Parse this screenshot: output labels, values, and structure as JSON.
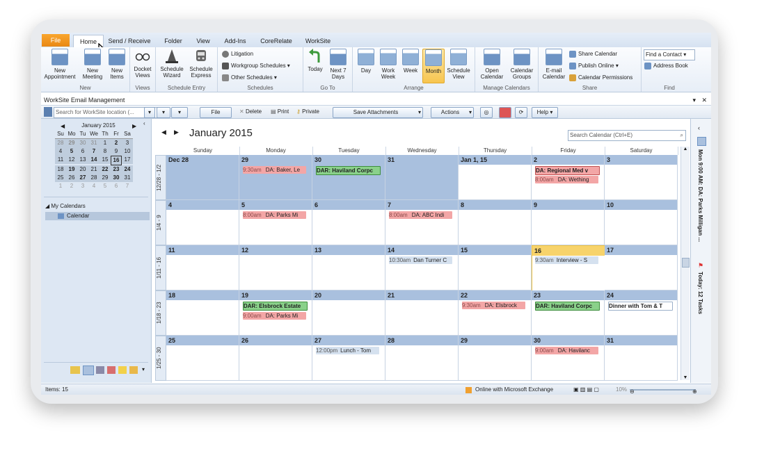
{
  "ribbon_tabs": [
    "File",
    "Home",
    "Send / Receive",
    "Folder",
    "View",
    "Add-Ins",
    "CoreRelate",
    "WorkSite"
  ],
  "ribbon": {
    "new": {
      "new_appointment": "New Appointment",
      "new_meeting": "New Meeting",
      "new_items": "New Items",
      "label": "New"
    },
    "views": {
      "docket_views": "Docket Views",
      "label": "Views"
    },
    "schedule_entry": {
      "schedule_wizard": "Schedule Wizard",
      "schedule_express": "Schedule Express",
      "label": "Schedule Entry"
    },
    "schedules": {
      "litigation": "Litigation",
      "workgroup": "Workgroup Schedules",
      "other": "Other Schedules",
      "label": "Schedules"
    },
    "goto": {
      "today": "Today",
      "next7": "Next 7 Days",
      "label": "Go To"
    },
    "arrange": {
      "day": "Day",
      "work_week": "Work Week",
      "week": "Week",
      "month": "Month",
      "schedule_view": "Schedule View",
      "label": "Arrange"
    },
    "manage": {
      "open_calendar": "Open Calendar",
      "calendar_groups": "Calendar Groups",
      "label": "Manage Calendars"
    },
    "share": {
      "email_calendar": "E-mail Calendar",
      "share_calendar": "Share Calendar",
      "publish_online": "Publish Online",
      "permissions": "Calendar Permissions",
      "label": "Share"
    },
    "find": {
      "find_contact": "Find a Contact",
      "address_book": "Address Book",
      "label": "Find"
    }
  },
  "worksite": {
    "title": "WorkSite Email Management",
    "search_placeholder": "Search for WorkSite location (...",
    "file": "File",
    "delete": "Delete",
    "print": "Print",
    "private": "Private",
    "save_attachments": "Save Attachments",
    "actions": "Actions",
    "help": "Help"
  },
  "mini_calendar": {
    "title": "January 2015",
    "weekdays": [
      "Su",
      "Mo",
      "Tu",
      "We",
      "Th",
      "Fr",
      "Sa"
    ]
  },
  "nav": {
    "my_calendars": "My Calendars",
    "calendar": "Calendar"
  },
  "calendar": {
    "title": "January 2015",
    "search_placeholder": "Search Calendar (Ctrl+E)",
    "days": [
      "Sunday",
      "Monday",
      "Tuesday",
      "Wednesday",
      "Thursday",
      "Friday",
      "Saturday"
    ],
    "weeks": [
      {
        "label": "12/28 - 1/2",
        "dates": [
          "Dec 28",
          "29",
          "30",
          "31",
          "Jan 1, 15",
          "2",
          "3"
        ]
      },
      {
        "label": "1/4 - 9",
        "dates": [
          "4",
          "5",
          "6",
          "7",
          "8",
          "9",
          "10"
        ]
      },
      {
        "label": "1/11 - 16",
        "dates": [
          "11",
          "12",
          "13",
          "14",
          "15",
          "16",
          "17"
        ]
      },
      {
        "label": "1/18 - 23",
        "dates": [
          "18",
          "19",
          "20",
          "21",
          "22",
          "23",
          "24"
        ]
      },
      {
        "label": "1/25 - 30",
        "dates": [
          "25",
          "26",
          "27",
          "28",
          "29",
          "30",
          "31"
        ]
      }
    ],
    "appointments": {
      "w0_mon": {
        "time": "9:30am",
        "text": "DA: Baker, Le"
      },
      "w0_tue": {
        "text": "DAR: Haviland Corpc"
      },
      "w0_fri_1": {
        "text": "DA: Regional Med v"
      },
      "w0_fri_2": {
        "time": "8:00am",
        "text": "DA: Wething"
      },
      "w1_mon": {
        "time": "8:00am",
        "text": "DA: Parks Mi"
      },
      "w1_wed": {
        "time": "8:00am",
        "text": "DA: ABC Indi"
      },
      "w2_wed": {
        "time": "10:30am",
        "text": "Dan Turner C"
      },
      "w2_fri": {
        "time": "9:30am",
        "text": "Interview - S"
      },
      "w3_mon_1": {
        "text": "DAR: Elsbrock Estate"
      },
      "w3_mon_2": {
        "time": "9:00am",
        "text": "DA: Parks Mi"
      },
      "w3_thu": {
        "time": "9:30am",
        "text": "DA: Elsbrock"
      },
      "w3_fri": {
        "text": "DAR: Haviland Corpc"
      },
      "w3_sat": {
        "text": "Dinner with Tom & T"
      },
      "w4_tue": {
        "time": "12:00pm",
        "text": "Lunch - Tom"
      },
      "w4_fri": {
        "time": "9:00am",
        "text": "DA: Havilanc"
      }
    }
  },
  "todo": {
    "appt": "Mon 9:00 AM: DA: Parks Milligan ...",
    "tasks": "Today: 12 Tasks"
  },
  "status": {
    "items": "Items: 15",
    "connection": "Online with Microsoft Exchange",
    "zoom": "10%"
  },
  "colors": {
    "accent": "#f7c54f",
    "appt_red": "#f3a6a6",
    "appt_green": "#8ad18a",
    "header_blue": "#a9c0de"
  }
}
